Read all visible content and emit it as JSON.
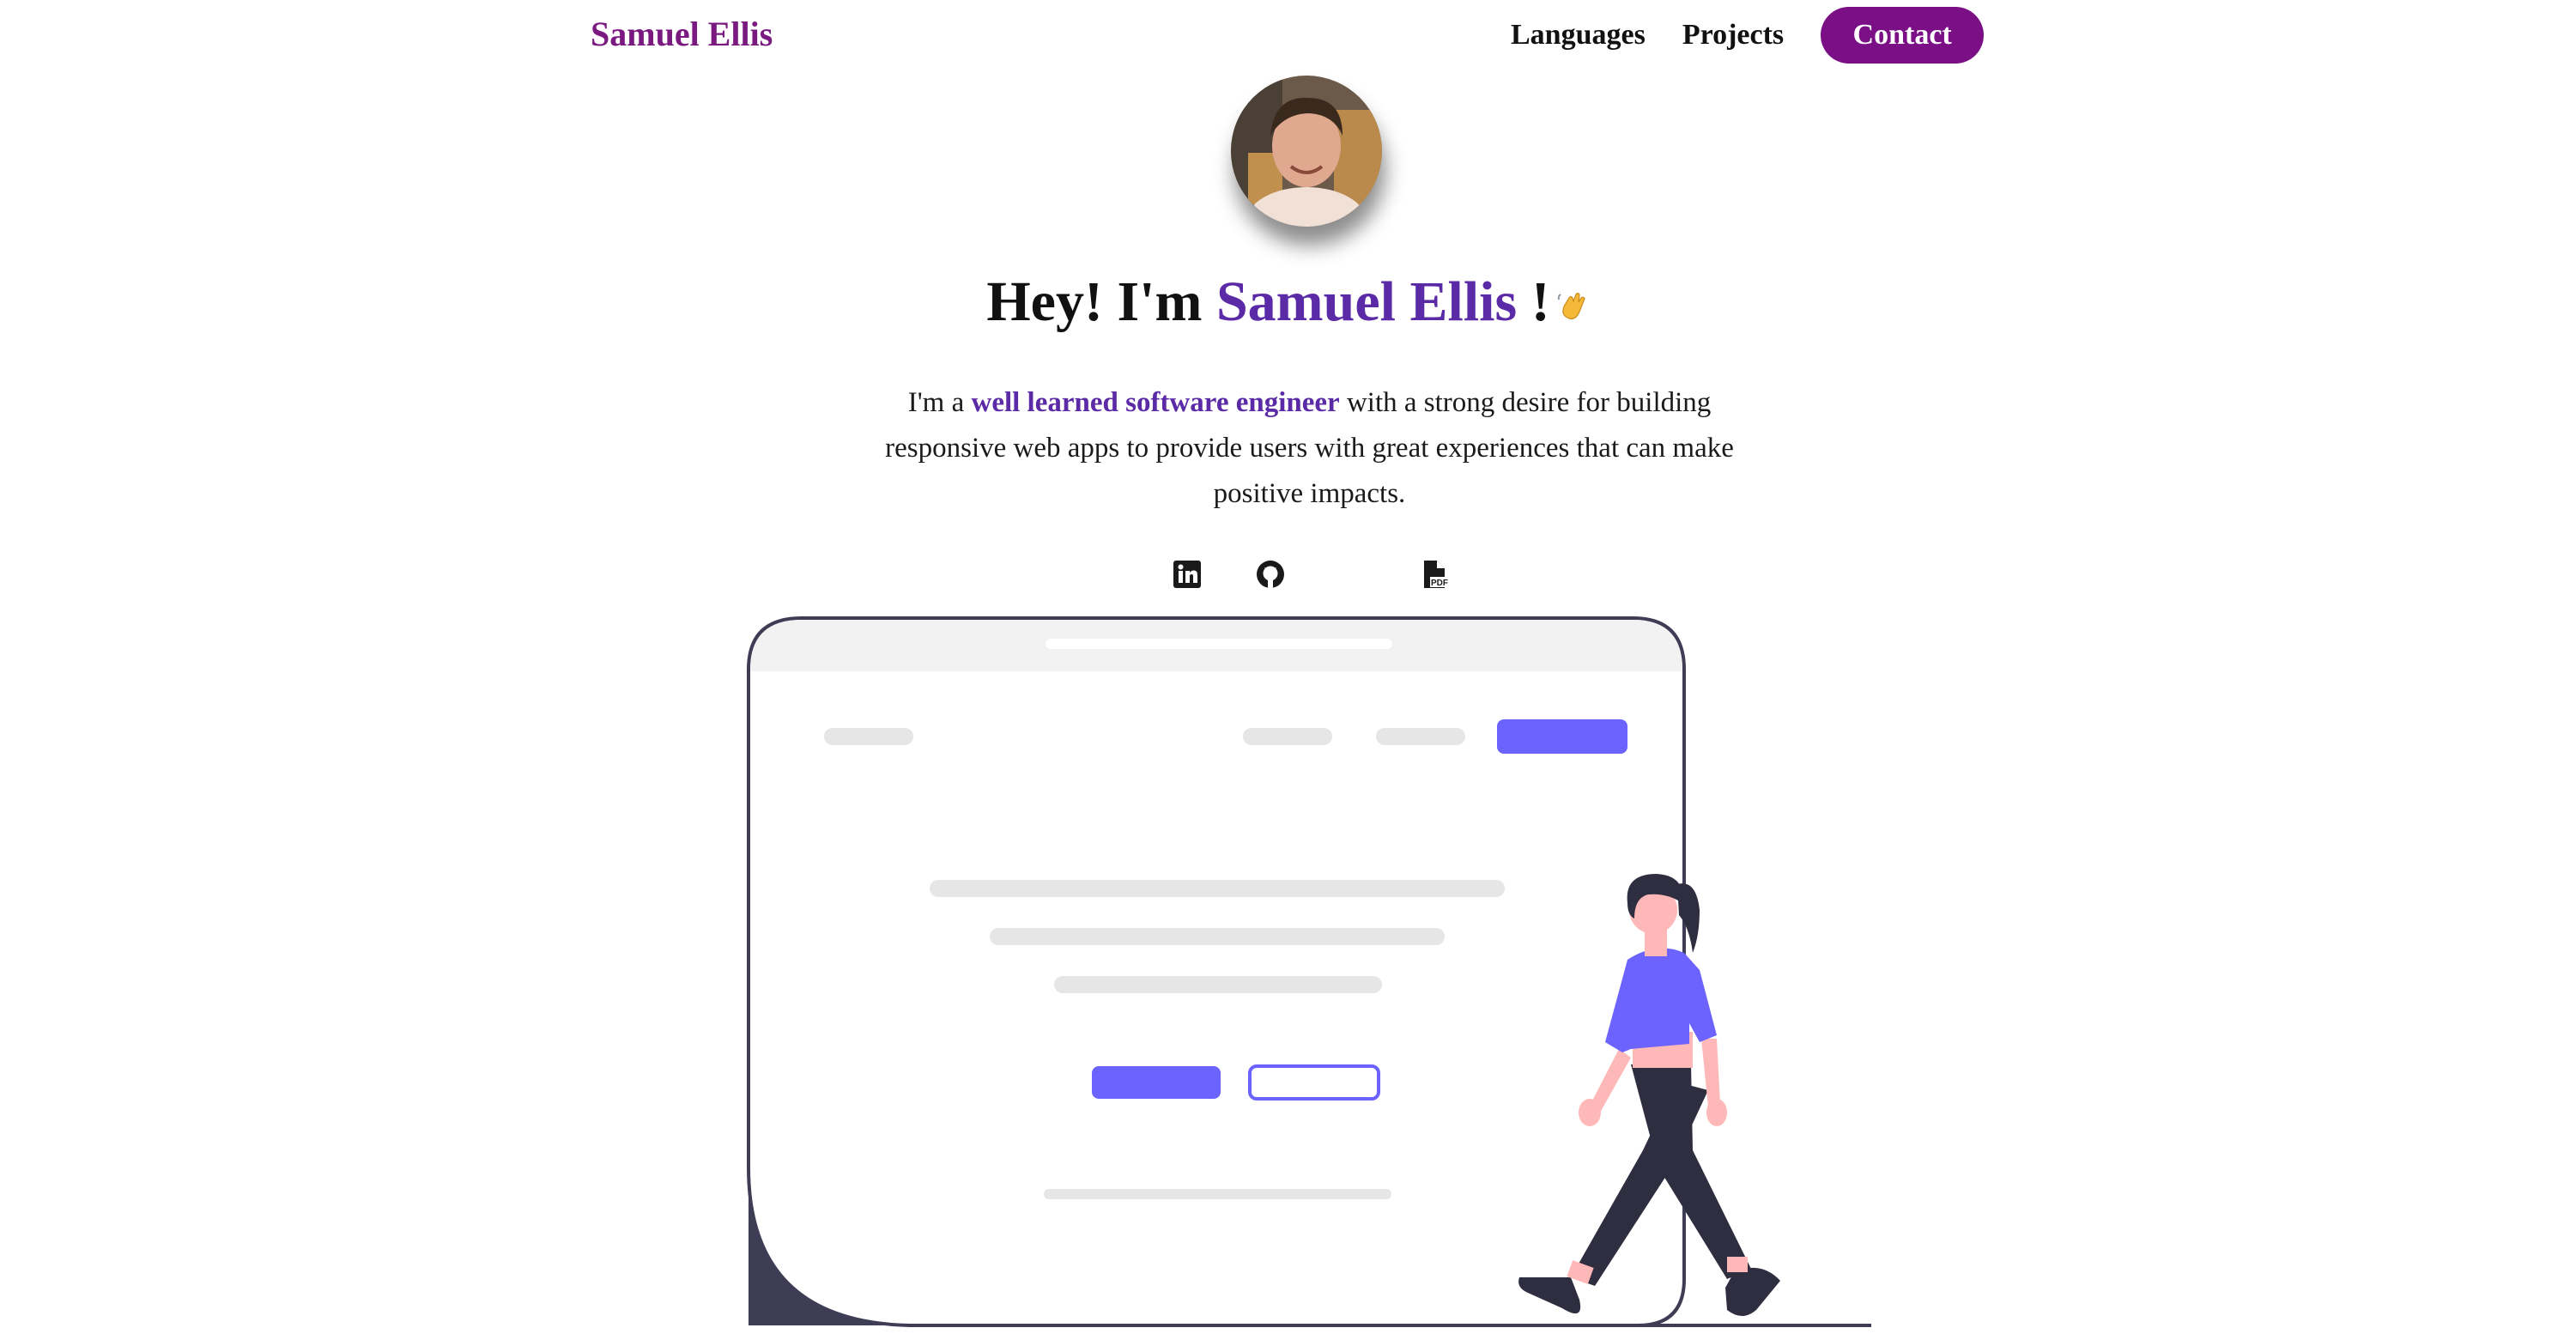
{
  "header": {
    "brand": "Samuel Ellis",
    "nav": {
      "languages": "Languages",
      "projects": "Projects",
      "contact": "Contact"
    }
  },
  "hero": {
    "greeting_prefix": "Hey! I'm ",
    "name": "Samuel Ellis",
    "greeting_suffix": " !",
    "emoji_icon": "waving-hand-icon"
  },
  "bio": {
    "prefix": "I'm a ",
    "highlight": "well learned software engineer",
    "suffix": " with a strong desire for building responsive web apps to provide users with great experiences that can make positive impacts."
  },
  "social": {
    "linkedin_icon": "linkedin-icon",
    "github_icon": "github-icon",
    "resume_icon": "pdf-file-icon",
    "resume_badge": "PDF"
  },
  "colors": {
    "brand": "#7a1a80",
    "contact_button": "#7a0f86",
    "name_highlight": "#5b2aa6",
    "illustration_accent": "#6c63ff",
    "illustration_dark": "#2f2e41"
  }
}
